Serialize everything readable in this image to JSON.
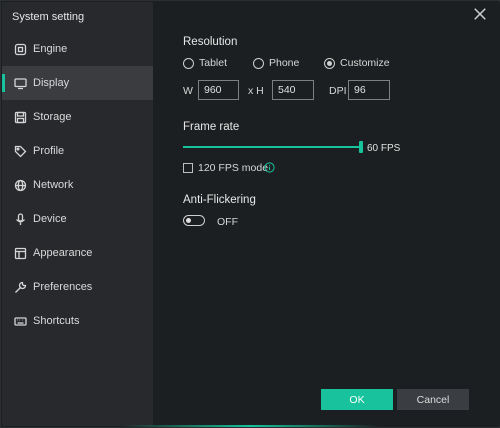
{
  "window": {
    "title": "System setting"
  },
  "sidebar": {
    "items": [
      {
        "label": "Engine",
        "icon": "gear-icon"
      },
      {
        "label": "Display",
        "icon": "monitor-icon",
        "active": true
      },
      {
        "label": "Storage",
        "icon": "disk-icon"
      },
      {
        "label": "Profile",
        "icon": "tag-icon"
      },
      {
        "label": "Network",
        "icon": "globe-icon"
      },
      {
        "label": "Device",
        "icon": "microphone-icon"
      },
      {
        "label": "Appearance",
        "icon": "appearance-icon"
      },
      {
        "label": "Preferences",
        "icon": "wrench-icon"
      },
      {
        "label": "Shortcuts",
        "icon": "keyboard-icon"
      }
    ]
  },
  "resolution": {
    "title": "Resolution",
    "options": [
      "Tablet",
      "Phone",
      "Customize"
    ],
    "selected": "Customize",
    "w_label": "W",
    "w_value": "960",
    "x_label": "x H",
    "h_value": "540",
    "dpi_label": "DPI",
    "dpi_value": "96"
  },
  "frame_rate": {
    "title": "Frame rate",
    "value_label": "60 FPS",
    "slider_fraction": 1.0,
    "fps120_label": "120 FPS mode",
    "fps120_checked": false
  },
  "anti_flickering": {
    "title": "Anti-Flickering",
    "state_label": "OFF"
  },
  "buttons": {
    "ok": "OK",
    "cancel": "Cancel"
  },
  "colors": {
    "accent": "#18c29c",
    "sidebar": "#27292c",
    "background": "#1c1f21"
  }
}
